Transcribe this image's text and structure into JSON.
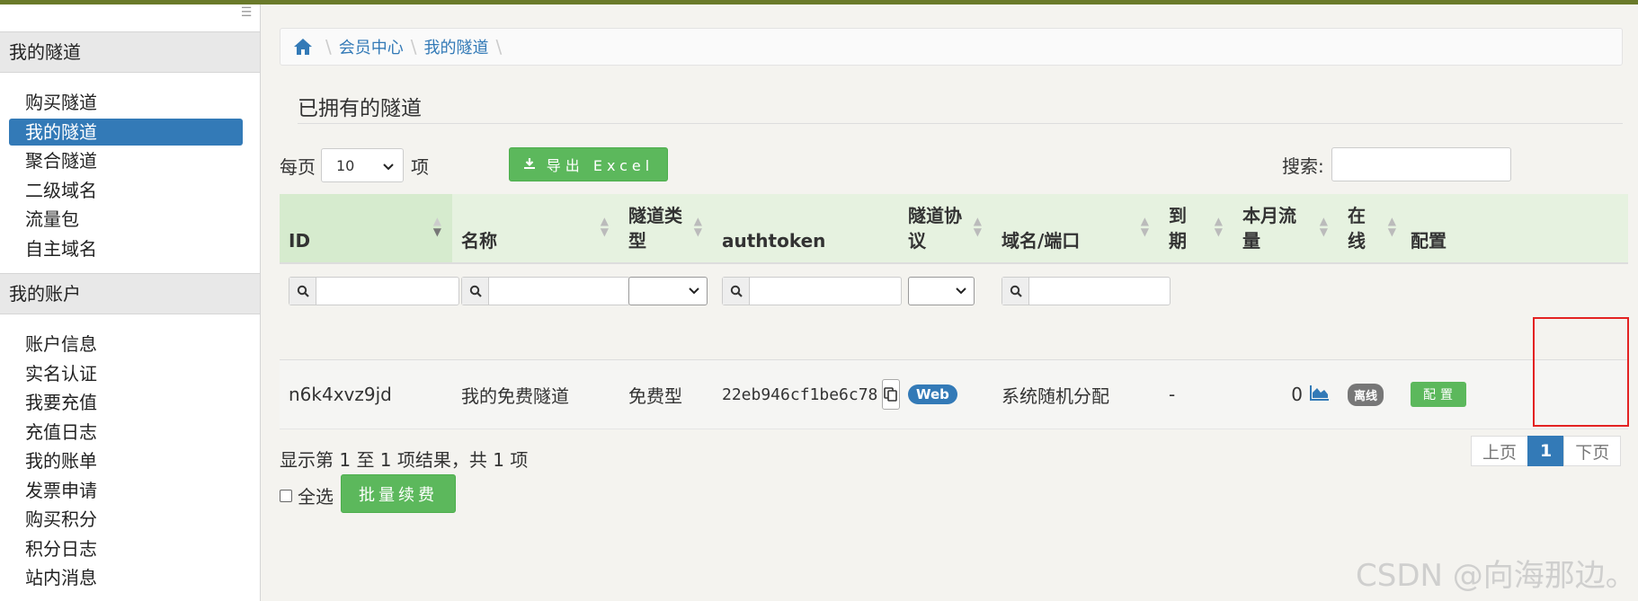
{
  "sidebar": {
    "sections": [
      {
        "header": "我的隧道",
        "items": [
          "购买隧道",
          "我的隧道",
          "聚合隧道",
          "二级域名",
          "流量包",
          "自主域名"
        ]
      },
      {
        "header": "我的账户",
        "items": [
          "账户信息",
          "实名认证",
          "我要充值",
          "充值日志",
          "我的账单",
          "发票申请",
          "购买积分",
          "积分日志",
          "站内消息"
        ]
      }
    ],
    "active_item": "我的隧道"
  },
  "breadcrumb": {
    "home_icon": "home-icon",
    "items": [
      "会员中心",
      "我的隧道"
    ]
  },
  "page_title": "已拥有的隧道",
  "toolbar": {
    "per_page_prefix": "每页",
    "per_page_value": "10",
    "per_page_suffix": "项",
    "export_label": "导出 Excel",
    "search_label": "搜索:"
  },
  "table": {
    "columns": [
      "ID",
      "名称",
      "隧道类型",
      "authtoken",
      "隧道协议",
      "域名/端口",
      "到期",
      "本月流量",
      "在线",
      "配置"
    ],
    "rows": [
      {
        "id": "n6k4xvz9jd",
        "name": "我的免费隧道",
        "type": "免费型",
        "authtoken": "22eb946cf1be6c78",
        "protocol": "Web",
        "domain": "系统随机分配",
        "expire": "-",
        "traffic": "0",
        "online": "离线",
        "config": "配置"
      }
    ]
  },
  "footer": {
    "info": "显示第 1 至 1 项结果，共 1 项",
    "select_all": "全选",
    "batch_renew": "批量续费",
    "prev": "上页",
    "current_page": "1",
    "next": "下页"
  },
  "watermark": "CSDN @向海那边。",
  "colors": {
    "primary": "#337ab7",
    "success": "#5cb85c",
    "highlight_box": "#e32222",
    "header_bg": "#e6f2e0"
  }
}
